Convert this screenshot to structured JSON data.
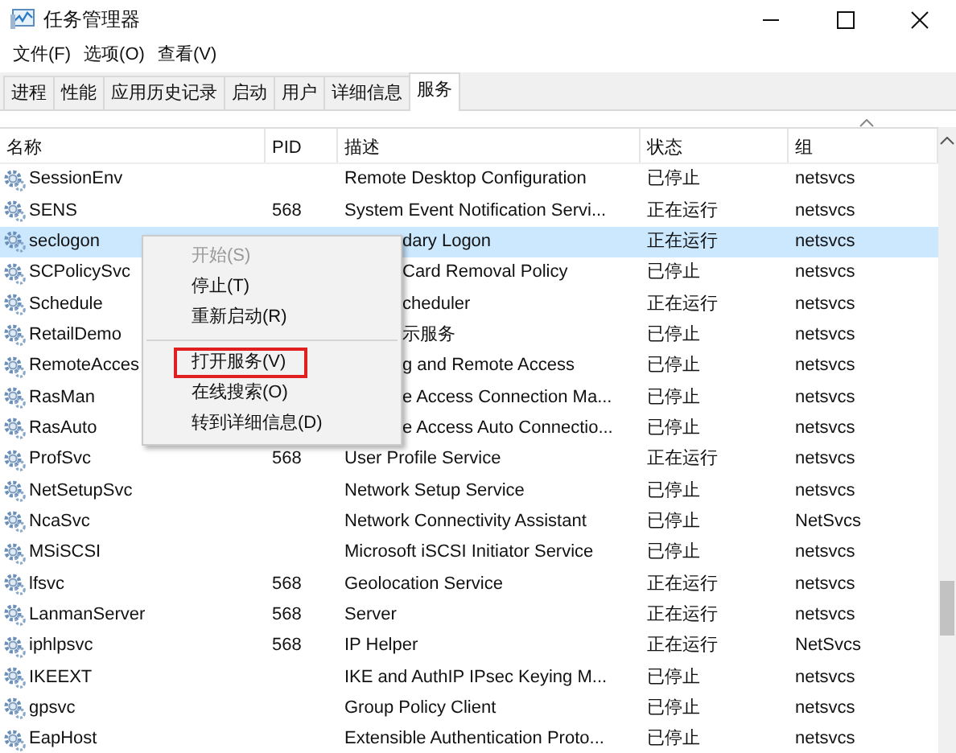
{
  "window": {
    "title": "任务管理器"
  },
  "menu": [
    "文件(F)",
    "选项(O)",
    "查看(V)"
  ],
  "tabs": [
    {
      "label": "进程",
      "selected": false
    },
    {
      "label": "性能",
      "selected": false
    },
    {
      "label": "应用历史记录",
      "selected": false
    },
    {
      "label": "启动",
      "selected": false
    },
    {
      "label": "用户",
      "selected": false
    },
    {
      "label": "详细信息",
      "selected": false
    },
    {
      "label": "服务",
      "selected": true
    }
  ],
  "table": {
    "columns": [
      "名称",
      "PID",
      "描述",
      "状态",
      "组"
    ],
    "rows": [
      {
        "name": "SessionEnv",
        "pid": "",
        "description": "Remote Desktop Configuration",
        "status": "已停止",
        "group": "netsvcs",
        "selected": false,
        "covered": false
      },
      {
        "name": "SENS",
        "pid": "568",
        "description": "System Event Notification Servi...",
        "status": "正在运行",
        "group": "netsvcs",
        "selected": false,
        "covered": false
      },
      {
        "name": "seclogon",
        "pid": "",
        "description": "dary Logon",
        "status": "正在运行",
        "group": "netsvcs",
        "selected": true,
        "covered": true
      },
      {
        "name": "SCPolicySvc",
        "pid": "",
        "description": "Card Removal Policy",
        "status": "已停止",
        "group": "netsvcs",
        "selected": false,
        "covered": true
      },
      {
        "name": "Schedule",
        "pid": "",
        "description": "cheduler",
        "status": "正在运行",
        "group": "netsvcs",
        "selected": false,
        "covered": true
      },
      {
        "name": "RetailDemo",
        "pid": "",
        "description": "示服务",
        "status": "已停止",
        "group": "netsvcs",
        "selected": false,
        "covered": true
      },
      {
        "name": "RemoteAcces",
        "pid": "",
        "description": "g and Remote Access",
        "status": "已停止",
        "group": "netsvcs",
        "selected": false,
        "covered": true
      },
      {
        "name": "RasMan",
        "pid": "",
        "description": "e Access Connection Ma...",
        "status": "已停止",
        "group": "netsvcs",
        "selected": false,
        "covered": true
      },
      {
        "name": "RasAuto",
        "pid": "",
        "description": "e Access Auto Connectio...",
        "status": "已停止",
        "group": "netsvcs",
        "selected": false,
        "covered": true
      },
      {
        "name": "ProfSvc",
        "pid": "568",
        "description": "User Profile Service",
        "status": "正在运行",
        "group": "netsvcs",
        "selected": false,
        "covered": false
      },
      {
        "name": "NetSetupSvc",
        "pid": "",
        "description": "Network Setup Service",
        "status": "已停止",
        "group": "netsvcs",
        "selected": false,
        "covered": false
      },
      {
        "name": "NcaSvc",
        "pid": "",
        "description": "Network Connectivity Assistant",
        "status": "已停止",
        "group": "NetSvcs",
        "selected": false,
        "covered": false
      },
      {
        "name": "MSiSCSI",
        "pid": "",
        "description": "Microsoft iSCSI Initiator Service",
        "status": "已停止",
        "group": "netsvcs",
        "selected": false,
        "covered": false
      },
      {
        "name": "lfsvc",
        "pid": "568",
        "description": "Geolocation Service",
        "status": "正在运行",
        "group": "netsvcs",
        "selected": false,
        "covered": false
      },
      {
        "name": "LanmanServer",
        "pid": "568",
        "description": "Server",
        "status": "正在运行",
        "group": "netsvcs",
        "selected": false,
        "covered": false
      },
      {
        "name": "iphlpsvc",
        "pid": "568",
        "description": "IP Helper",
        "status": "正在运行",
        "group": "NetSvcs",
        "selected": false,
        "covered": false
      },
      {
        "name": "IKEEXT",
        "pid": "",
        "description": "IKE and AuthIP IPsec Keying M...",
        "status": "已停止",
        "group": "netsvcs",
        "selected": false,
        "covered": false
      },
      {
        "name": "gpsvc",
        "pid": "",
        "description": "Group Policy Client",
        "status": "已停止",
        "group": "netsvcs",
        "selected": false,
        "covered": false
      },
      {
        "name": "EapHost",
        "pid": "",
        "description": "Extensible Authentication Proto...",
        "status": "已停止",
        "group": "netsvcs",
        "selected": false,
        "covered": false
      }
    ]
  },
  "context_menu": {
    "items": [
      {
        "kind": "item",
        "label": "开始(S)",
        "disabled": true,
        "highlighted": false
      },
      {
        "kind": "item",
        "label": "停止(T)",
        "disabled": false,
        "highlighted": false
      },
      {
        "kind": "item",
        "label": "重新启动(R)",
        "disabled": false,
        "highlighted": false
      },
      {
        "kind": "separator"
      },
      {
        "kind": "item",
        "label": "打开服务(V)",
        "disabled": false,
        "highlighted": true
      },
      {
        "kind": "item",
        "label": "在线搜索(O)",
        "disabled": false,
        "highlighted": false
      },
      {
        "kind": "item",
        "label": "转到详细信息(D)",
        "disabled": false,
        "highlighted": false
      }
    ]
  }
}
